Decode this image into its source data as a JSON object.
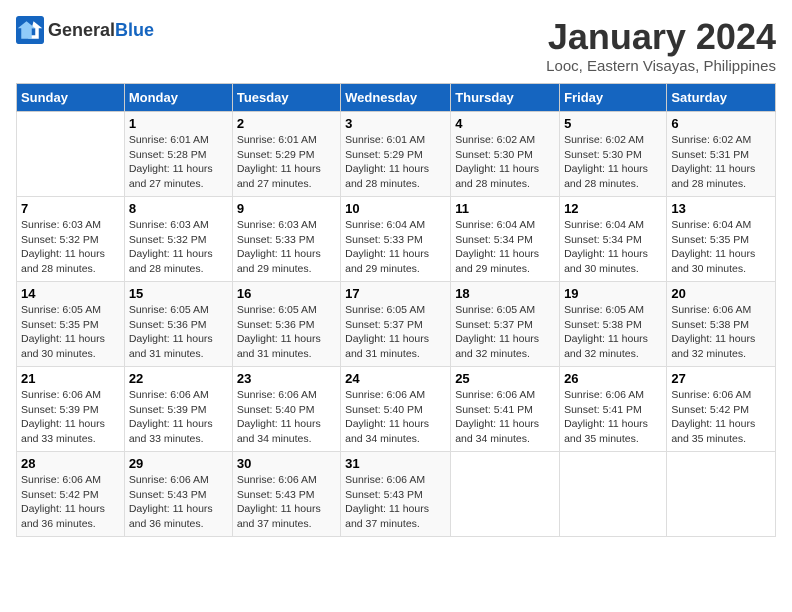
{
  "header": {
    "logo_general": "General",
    "logo_blue": "Blue",
    "title": "January 2024",
    "location": "Looc, Eastern Visayas, Philippines"
  },
  "days_of_week": [
    "Sunday",
    "Monday",
    "Tuesday",
    "Wednesday",
    "Thursday",
    "Friday",
    "Saturday"
  ],
  "weeks": [
    [
      {
        "day": "",
        "sunrise": "",
        "sunset": "",
        "daylight": ""
      },
      {
        "day": "1",
        "sunrise": "6:01 AM",
        "sunset": "5:28 PM",
        "daylight": "11 hours and 27 minutes."
      },
      {
        "day": "2",
        "sunrise": "6:01 AM",
        "sunset": "5:29 PM",
        "daylight": "11 hours and 27 minutes."
      },
      {
        "day": "3",
        "sunrise": "6:01 AM",
        "sunset": "5:29 PM",
        "daylight": "11 hours and 28 minutes."
      },
      {
        "day": "4",
        "sunrise": "6:02 AM",
        "sunset": "5:30 PM",
        "daylight": "11 hours and 28 minutes."
      },
      {
        "day": "5",
        "sunrise": "6:02 AM",
        "sunset": "5:30 PM",
        "daylight": "11 hours and 28 minutes."
      },
      {
        "day": "6",
        "sunrise": "6:02 AM",
        "sunset": "5:31 PM",
        "daylight": "11 hours and 28 minutes."
      }
    ],
    [
      {
        "day": "7",
        "sunrise": "6:03 AM",
        "sunset": "5:32 PM",
        "daylight": "11 hours and 28 minutes."
      },
      {
        "day": "8",
        "sunrise": "6:03 AM",
        "sunset": "5:32 PM",
        "daylight": "11 hours and 28 minutes."
      },
      {
        "day": "9",
        "sunrise": "6:03 AM",
        "sunset": "5:33 PM",
        "daylight": "11 hours and 29 minutes."
      },
      {
        "day": "10",
        "sunrise": "6:04 AM",
        "sunset": "5:33 PM",
        "daylight": "11 hours and 29 minutes."
      },
      {
        "day": "11",
        "sunrise": "6:04 AM",
        "sunset": "5:34 PM",
        "daylight": "11 hours and 29 minutes."
      },
      {
        "day": "12",
        "sunrise": "6:04 AM",
        "sunset": "5:34 PM",
        "daylight": "11 hours and 30 minutes."
      },
      {
        "day": "13",
        "sunrise": "6:04 AM",
        "sunset": "5:35 PM",
        "daylight": "11 hours and 30 minutes."
      }
    ],
    [
      {
        "day": "14",
        "sunrise": "6:05 AM",
        "sunset": "5:35 PM",
        "daylight": "11 hours and 30 minutes."
      },
      {
        "day": "15",
        "sunrise": "6:05 AM",
        "sunset": "5:36 PM",
        "daylight": "11 hours and 31 minutes."
      },
      {
        "day": "16",
        "sunrise": "6:05 AM",
        "sunset": "5:36 PM",
        "daylight": "11 hours and 31 minutes."
      },
      {
        "day": "17",
        "sunrise": "6:05 AM",
        "sunset": "5:37 PM",
        "daylight": "11 hours and 31 minutes."
      },
      {
        "day": "18",
        "sunrise": "6:05 AM",
        "sunset": "5:37 PM",
        "daylight": "11 hours and 32 minutes."
      },
      {
        "day": "19",
        "sunrise": "6:05 AM",
        "sunset": "5:38 PM",
        "daylight": "11 hours and 32 minutes."
      },
      {
        "day": "20",
        "sunrise": "6:06 AM",
        "sunset": "5:38 PM",
        "daylight": "11 hours and 32 minutes."
      }
    ],
    [
      {
        "day": "21",
        "sunrise": "6:06 AM",
        "sunset": "5:39 PM",
        "daylight": "11 hours and 33 minutes."
      },
      {
        "day": "22",
        "sunrise": "6:06 AM",
        "sunset": "5:39 PM",
        "daylight": "11 hours and 33 minutes."
      },
      {
        "day": "23",
        "sunrise": "6:06 AM",
        "sunset": "5:40 PM",
        "daylight": "11 hours and 34 minutes."
      },
      {
        "day": "24",
        "sunrise": "6:06 AM",
        "sunset": "5:40 PM",
        "daylight": "11 hours and 34 minutes."
      },
      {
        "day": "25",
        "sunrise": "6:06 AM",
        "sunset": "5:41 PM",
        "daylight": "11 hours and 34 minutes."
      },
      {
        "day": "26",
        "sunrise": "6:06 AM",
        "sunset": "5:41 PM",
        "daylight": "11 hours and 35 minutes."
      },
      {
        "day": "27",
        "sunrise": "6:06 AM",
        "sunset": "5:42 PM",
        "daylight": "11 hours and 35 minutes."
      }
    ],
    [
      {
        "day": "28",
        "sunrise": "6:06 AM",
        "sunset": "5:42 PM",
        "daylight": "11 hours and 36 minutes."
      },
      {
        "day": "29",
        "sunrise": "6:06 AM",
        "sunset": "5:43 PM",
        "daylight": "11 hours and 36 minutes."
      },
      {
        "day": "30",
        "sunrise": "6:06 AM",
        "sunset": "5:43 PM",
        "daylight": "11 hours and 37 minutes."
      },
      {
        "day": "31",
        "sunrise": "6:06 AM",
        "sunset": "5:43 PM",
        "daylight": "11 hours and 37 minutes."
      },
      {
        "day": "",
        "sunrise": "",
        "sunset": "",
        "daylight": ""
      },
      {
        "day": "",
        "sunrise": "",
        "sunset": "",
        "daylight": ""
      },
      {
        "day": "",
        "sunrise": "",
        "sunset": "",
        "daylight": ""
      }
    ]
  ]
}
